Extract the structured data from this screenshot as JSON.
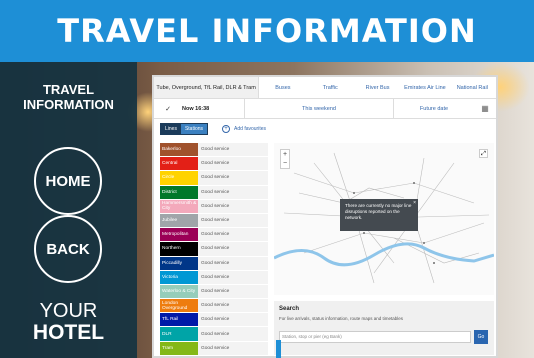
{
  "header": {
    "title": "TRAVEL INFORMATION"
  },
  "sidebar": {
    "title_line1": "TRAVEL",
    "title_line2": "INFORMATION",
    "home_label": "HOME",
    "back_label": "BACK",
    "hotel_line1": "YOUR",
    "hotel_line2": "HOTEL"
  },
  "tabs": [
    {
      "label": "Tube, Overground, TfL Rail, DLR & Tram"
    },
    {
      "label": "Buses"
    },
    {
      "label": "Traffic"
    },
    {
      "label": "River Bus"
    },
    {
      "label": "Emirates Air Line"
    },
    {
      "label": "National Rail"
    }
  ],
  "date_row": {
    "now": "Now 16:38",
    "weekend": "This weekend",
    "future": "Future date"
  },
  "toolbar": {
    "lines_label": "Lines",
    "stations_label": "Stations",
    "fav_label": "Add favourites"
  },
  "lines": [
    {
      "name": "Bakerloo",
      "color": "#a0522d",
      "status": "Good service"
    },
    {
      "name": "Central",
      "color": "#e32017",
      "status": "Good service"
    },
    {
      "name": "Circle",
      "color": "#ffd300",
      "status": "Good service"
    },
    {
      "name": "District",
      "color": "#00782a",
      "status": "Good service"
    },
    {
      "name": "Hammersmith & City",
      "color": "#f3a9bb",
      "status": "Good service"
    },
    {
      "name": "Jubilee",
      "color": "#a0a5a9",
      "status": "Good service"
    },
    {
      "name": "Metropolitan",
      "color": "#9b0056",
      "status": "Good service"
    },
    {
      "name": "Northern",
      "color": "#000000",
      "status": "Good service"
    },
    {
      "name": "Piccadilly",
      "color": "#003688",
      "status": "Good service"
    },
    {
      "name": "Victoria",
      "color": "#0098d4",
      "status": "Good service"
    },
    {
      "name": "Waterloo & City",
      "color": "#95cdba",
      "status": "Good service"
    },
    {
      "name": "London Overground",
      "color": "#ee7c0e",
      "status": "Good service"
    },
    {
      "name": "TfL Rail",
      "color": "#0019a8",
      "status": "Good service"
    },
    {
      "name": "DLR",
      "color": "#00a4a7",
      "status": "Good service"
    },
    {
      "name": "Tram",
      "color": "#84b817",
      "status": "Good service"
    }
  ],
  "map": {
    "popup_text": "There are currently no major line disruptions reported on the network.",
    "zoom_in": "+",
    "zoom_out": "−"
  },
  "search": {
    "title": "Search",
    "subtitle": "For live arrivals, status information, route maps and timetables",
    "placeholder": "Station, stop or pier (eg Bank)",
    "go_label": "Go"
  },
  "colors": {
    "header_blue": "#1e8fd6",
    "sidebar": "#163442",
    "button_blue": "#2a66b0"
  }
}
